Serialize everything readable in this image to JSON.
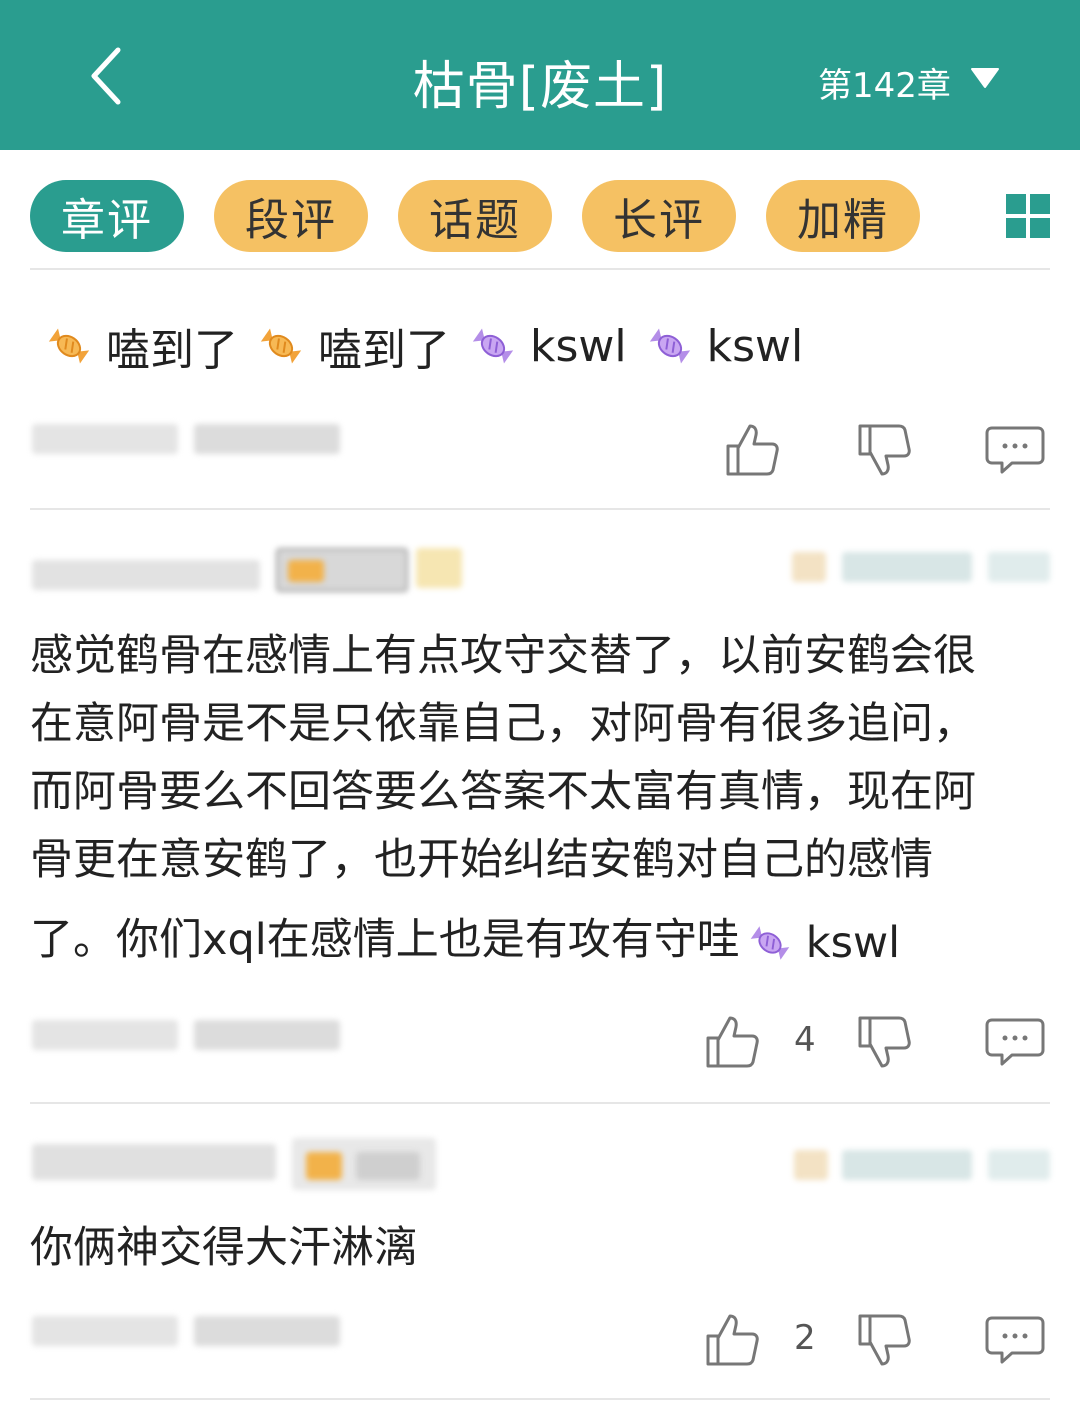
{
  "theme": {
    "brand": "#2a9d8f",
    "gold": "#f5c163"
  },
  "header": {
    "title": "枯骨[废土]",
    "chapter": "第142章",
    "back_icon": "chevron-left-icon",
    "dropdown_icon": "caret-down-icon"
  },
  "tabs": [
    {
      "label": "章评",
      "active": true
    },
    {
      "label": "段评",
      "active": false
    },
    {
      "label": "话题",
      "active": false
    },
    {
      "label": "长评",
      "active": false
    },
    {
      "label": "加精",
      "active": false
    }
  ],
  "reactions": [
    {
      "label": "嗑到了",
      "icon": "candy-orange-icon"
    },
    {
      "label": "嗑到了",
      "icon": "candy-orange-icon"
    },
    {
      "label": "kswl",
      "icon": "candy-purple-icon"
    },
    {
      "label": "kswl",
      "icon": "candy-purple-icon"
    }
  ],
  "comments": [
    {
      "lines": [
        "感觉鹤骨在感情上有点攻守交替了，以前安鹤会很",
        "在意阿骨是不是只依靠自己，对阿骨有很多追问，",
        "而阿骨要么不回答要么答案不太富有真情，现在阿",
        "骨更在意安鹤了，也开始纠结安鹤对自己的感情",
        "了。你们xql在感情上也是有攻有守哇"
      ],
      "inline_chip": "kswl",
      "likes": "4"
    },
    {
      "lines": [
        "你俩神交得大汗淋漓"
      ],
      "likes": "2"
    }
  ]
}
